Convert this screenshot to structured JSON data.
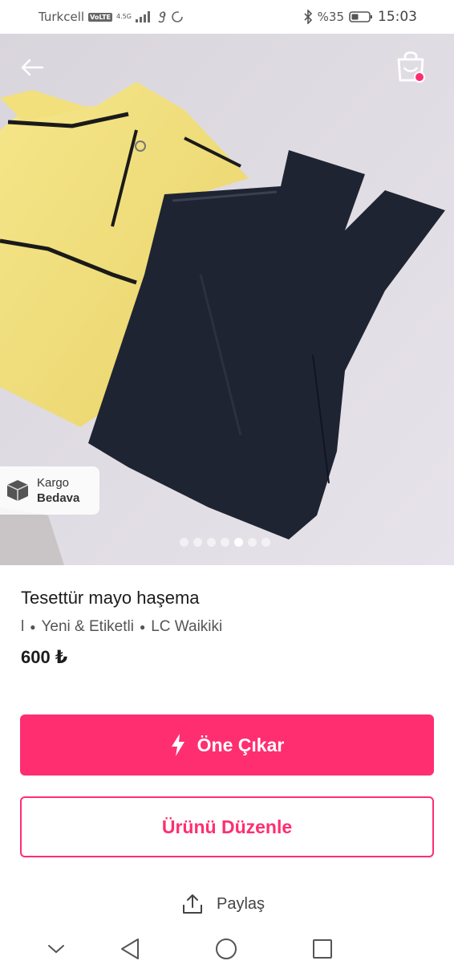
{
  "status_bar": {
    "carrier": "Turkcell",
    "volte": "VoLTE",
    "network": "4.5G",
    "battery": "%35",
    "time": "15:03"
  },
  "hero": {
    "back_icon": "arrow-left-icon",
    "bag_icon": "shopping-bag-icon",
    "cargo_line1": "Kargo",
    "cargo_line2": "Bedava",
    "image_count": 7,
    "active_image": 5
  },
  "product": {
    "title": "Tesettür mayo haşema",
    "size": "l",
    "condition": "Yeni & Etiketli",
    "brand": "LC Waikiki",
    "price": "600 ₺"
  },
  "actions": {
    "promote_label": "Öne Çıkar",
    "promote_icon": "lightning-icon",
    "edit_label": "Ürünü Düzenle",
    "share_label": "Paylaş",
    "share_icon": "share-icon"
  },
  "colors": {
    "accent": "#ff2e70"
  }
}
